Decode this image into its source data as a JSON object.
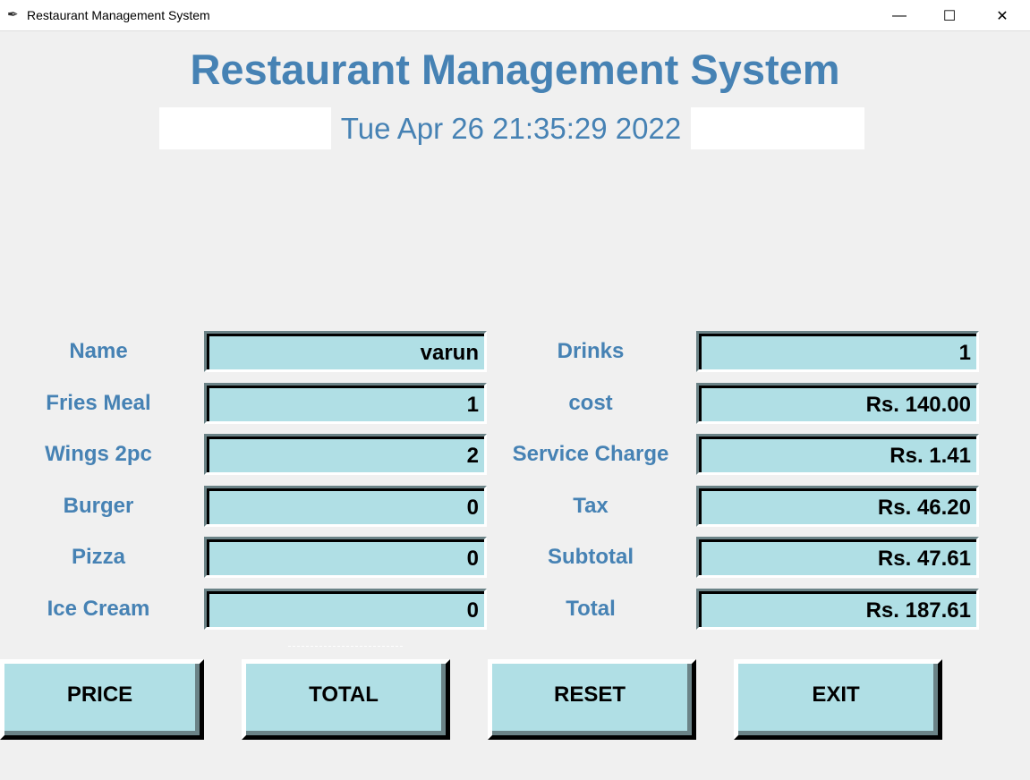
{
  "window": {
    "title": "Restaurant Management System",
    "minimize": "—",
    "maximize": "☐",
    "close": "✕",
    "icon": "feather-icon"
  },
  "header": {
    "title": "Restaurant Management System",
    "datetime": "Tue Apr 26 21:35:29 2022"
  },
  "left_fields": [
    {
      "label": "Name",
      "value": "varun"
    },
    {
      "label": "Fries Meal",
      "value": "1"
    },
    {
      "label": "Wings 2pc",
      "value": "2"
    },
    {
      "label": "Burger",
      "value": "0"
    },
    {
      "label": "Pizza",
      "value": "0"
    },
    {
      "label": "Ice Cream",
      "value": "0"
    }
  ],
  "right_fields": [
    {
      "label": "Drinks",
      "value": "1"
    },
    {
      "label": "cost",
      "value": "Rs. 140.00"
    },
    {
      "label": "Service Charge",
      "value": "Rs. 1.41"
    },
    {
      "label": "Tax",
      "value": "Rs. 46.20"
    },
    {
      "label": "Subtotal",
      "value": "Rs. 47.61"
    },
    {
      "label": "Total",
      "value": "Rs. 187.61"
    }
  ],
  "buttons": {
    "price": "PRICE",
    "total": "TOTAL",
    "reset": "RESET",
    "exit": "EXIT"
  },
  "colors": {
    "accent": "#4682b4",
    "field_bg": "#b0dfe5"
  }
}
